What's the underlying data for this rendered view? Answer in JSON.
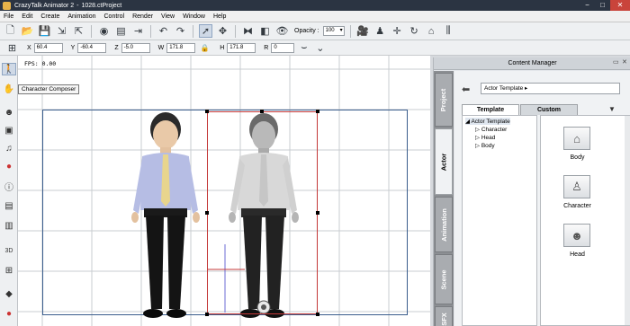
{
  "window": {
    "app_name": "CrazyTalk Animator 2",
    "separator": "-",
    "project": "1028.ctProject",
    "minimize_glyph": "−",
    "maximize_glyph": "□",
    "close_glyph": "✕"
  },
  "menu": [
    "File",
    "Edit",
    "Create",
    "Animation",
    "Control",
    "Render",
    "View",
    "Window",
    "Help"
  ],
  "toolbar": {
    "opacity_label": "Opacity :",
    "opacity_value": "100"
  },
  "transform": {
    "x_label": "X",
    "x_value": "60.4",
    "y_label": "Y",
    "y_value": "-60.4",
    "z_label": "Z",
    "z_value": "-5.0",
    "w_label": "W",
    "w_value": "171.8",
    "h_label": "H",
    "h_value": "171.8",
    "r_label": "R",
    "r_value": "0"
  },
  "stage": {
    "fps_text": "FPS: 0.00",
    "tooltip": "Character Composer"
  },
  "content_manager": {
    "title": "Content Manager",
    "side_tabs": [
      "Project",
      "Actor",
      "Animation",
      "Scene",
      "SFX"
    ],
    "path": "Actor Template ▸",
    "tabs": [
      "Template",
      "Custom"
    ],
    "tree": {
      "root": "Actor Template",
      "children": [
        "Character",
        "Head",
        "Body"
      ]
    },
    "items": [
      {
        "label": "Body",
        "icon": "body-template-icon"
      },
      {
        "label": "Character",
        "icon": "character-template-icon"
      },
      {
        "label": "Head",
        "icon": "head-template-icon"
      }
    ]
  },
  "colors": {
    "title_bar": "#2b3442",
    "frame_blue": "#3a5d8c",
    "frame_red": "#c43838"
  }
}
